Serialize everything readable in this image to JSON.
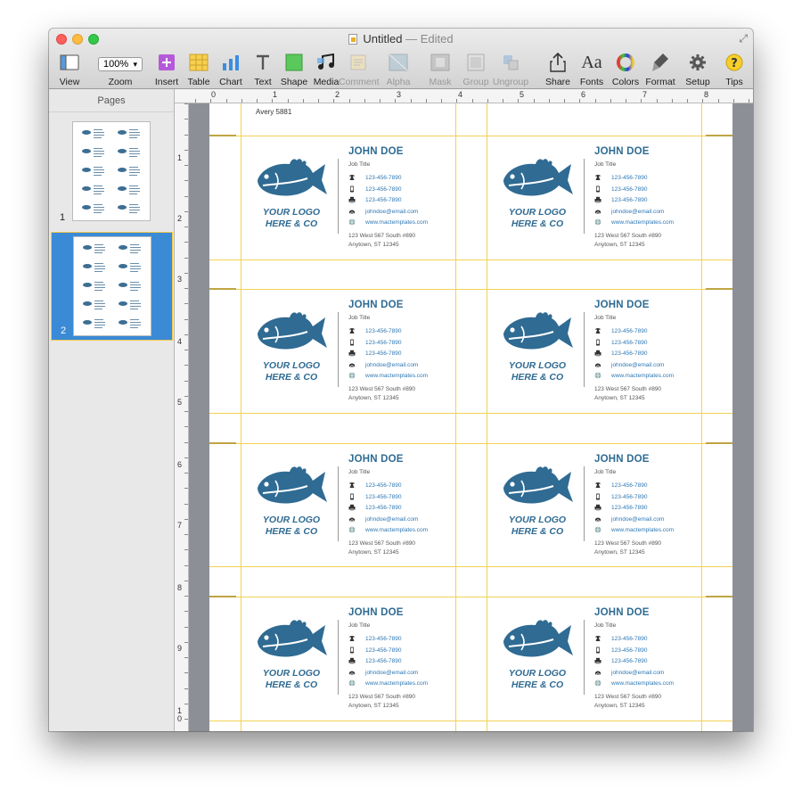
{
  "window": {
    "title": "Untitled",
    "status": "— Edited"
  },
  "toolbar": {
    "items": [
      {
        "label": "View",
        "icon": "view-icon",
        "enabled": true
      },
      {
        "label": "Zoom",
        "icon": "zoom-select",
        "enabled": true,
        "value": "100%"
      },
      {
        "label": "Insert",
        "icon": "insert-icon",
        "enabled": true
      },
      {
        "label": "Table",
        "icon": "table-icon",
        "enabled": true
      },
      {
        "label": "Chart",
        "icon": "chart-icon",
        "enabled": true
      },
      {
        "label": "Text",
        "icon": "text-icon",
        "enabled": true
      },
      {
        "label": "Shape",
        "icon": "shape-icon",
        "enabled": true
      },
      {
        "label": "Media",
        "icon": "media-icon",
        "enabled": true
      },
      {
        "label": "Comment",
        "icon": "comment-icon",
        "enabled": false
      },
      {
        "label": "Alpha",
        "icon": "alpha-icon",
        "enabled": false
      },
      {
        "label": "Mask",
        "icon": "mask-icon",
        "enabled": false
      },
      {
        "label": "Group",
        "icon": "group-icon",
        "enabled": false
      },
      {
        "label": "Ungroup",
        "icon": "ungroup-icon",
        "enabled": false
      },
      {
        "label": "Share",
        "icon": "share-icon",
        "enabled": true
      },
      {
        "label": "Fonts",
        "icon": "fonts-icon",
        "enabled": true
      },
      {
        "label": "Colors",
        "icon": "colors-icon",
        "enabled": true
      },
      {
        "label": "Format",
        "icon": "format-icon",
        "enabled": true
      },
      {
        "label": "Setup",
        "icon": "setup-icon",
        "enabled": true
      },
      {
        "label": "Tips",
        "icon": "tips-icon",
        "enabled": true
      }
    ]
  },
  "sidebar": {
    "title": "Pages",
    "pages": [
      {
        "number": "1",
        "selected": false
      },
      {
        "number": "2",
        "selected": true
      }
    ]
  },
  "rulers": {
    "top": [
      "0",
      "1",
      "2",
      "3",
      "4",
      "5",
      "6",
      "7",
      "8"
    ],
    "left": [
      "1",
      "2",
      "3",
      "4",
      "5",
      "6",
      "7",
      "8",
      "9",
      "1",
      "0"
    ]
  },
  "page": {
    "label": "Avery 5881"
  },
  "card": {
    "name": "JOHN DOE",
    "job_title": "Job Title",
    "logo_line1": "YOUR LOGO",
    "logo_line2": "HERE & CO",
    "phone1": "123-456-7890",
    "phone2": "123-456-7890",
    "phone3": "123-456-7890",
    "email": "johndoe@email.com",
    "website": "www.mactemplates.com",
    "address_line1": "123 West 567 South #890",
    "address_line2": "Anytown, ST 12345",
    "brand_color": "#2f6b93",
    "link_color": "#2e78b4",
    "guide_color": "#f2d155"
  }
}
